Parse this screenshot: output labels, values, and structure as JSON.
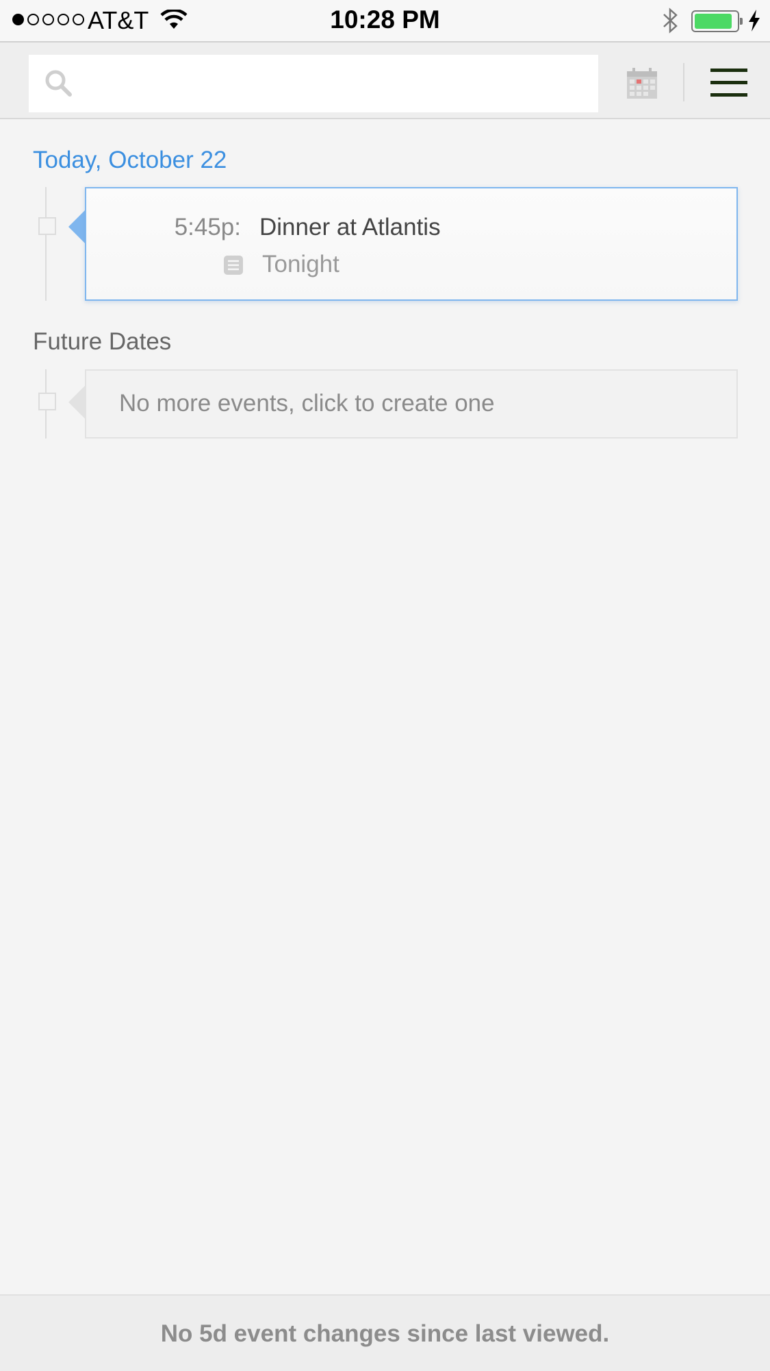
{
  "status_bar": {
    "carrier": "AT&T",
    "time": "10:28 PM",
    "signal_bars_filled": 1,
    "signal_bars_total": 5,
    "battery_level": 0.9,
    "charging": true
  },
  "toolbar": {
    "search_value": "",
    "icons": [
      "search-icon",
      "calendar-icon",
      "hamburger-menu-icon"
    ]
  },
  "today": {
    "title": "Today, October 22",
    "events": [
      {
        "time": "5:45p:",
        "title": "Dinner at Atlantis",
        "note": "Tonight"
      }
    ]
  },
  "future": {
    "title": "Future Dates",
    "empty_message": "No more events, click to create one"
  },
  "footer": {
    "message": "No 5d event changes since last viewed."
  },
  "colors": {
    "accent": "#3b8fe0",
    "card_border": "#7fb6ee",
    "battery": "#4cd964",
    "menu_icon": "#1a2e0e"
  }
}
